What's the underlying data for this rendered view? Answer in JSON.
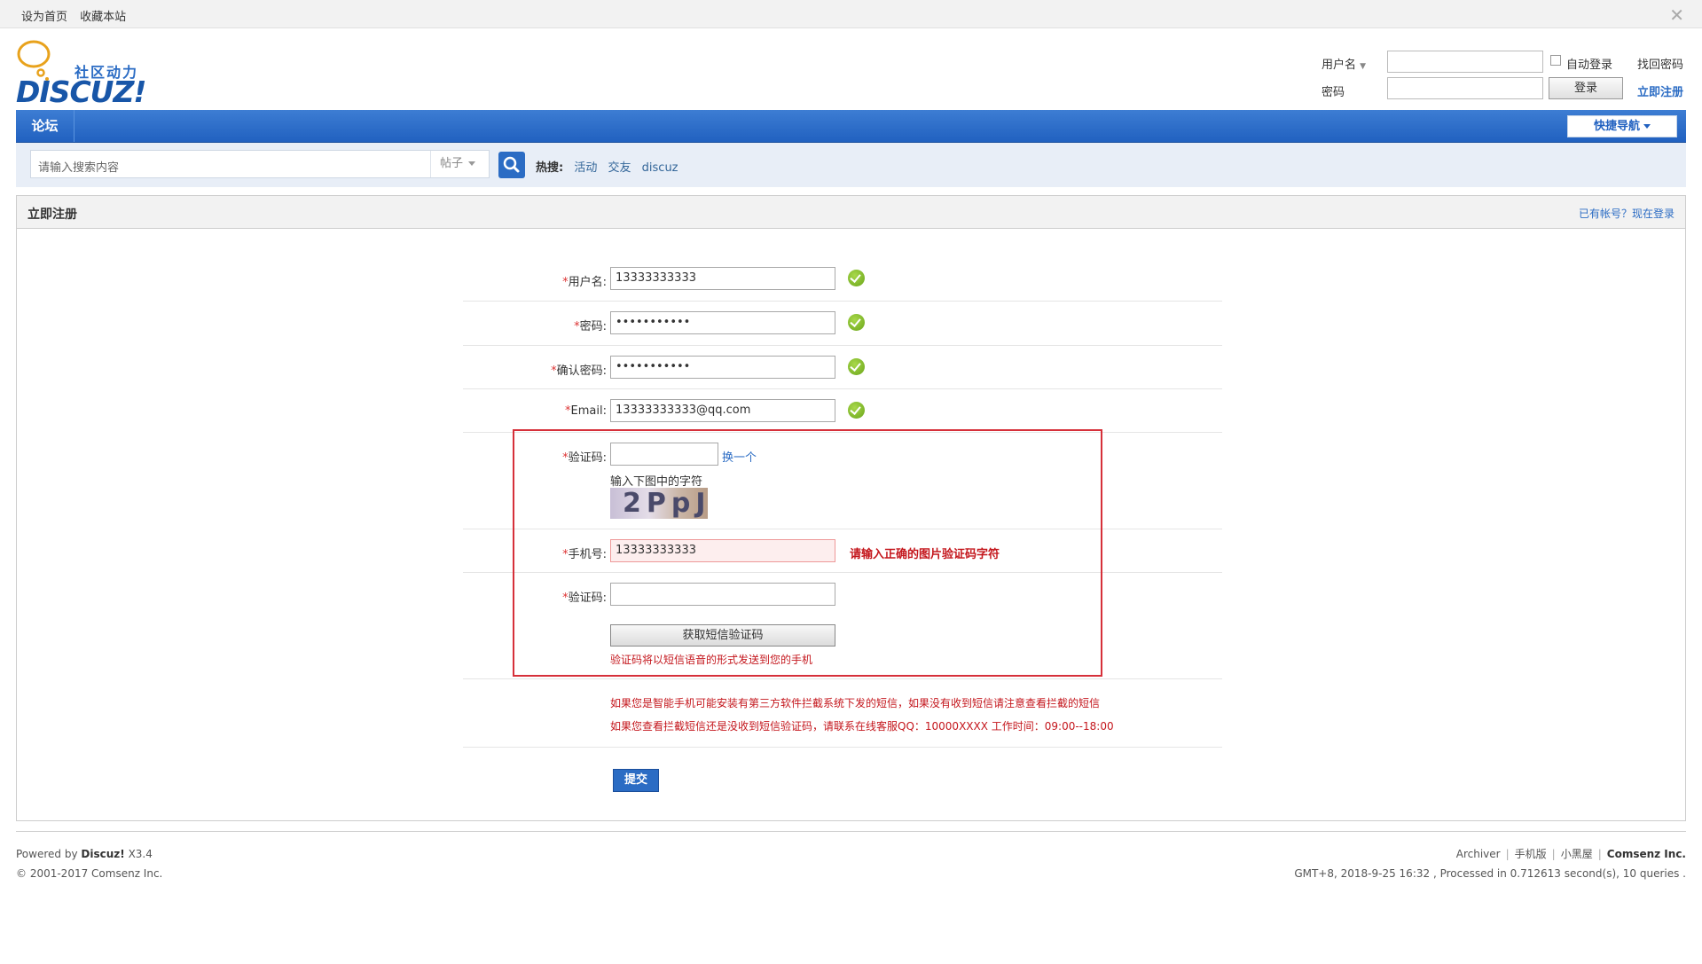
{
  "topbar": {
    "set_home": "设为首页",
    "bookmark": "收藏本站"
  },
  "logo": {
    "tagline": "社区动力",
    "wordmark": "DISCUZ!"
  },
  "login": {
    "username_label": "用户名",
    "password_label": "密码",
    "auto_login": "自动登录",
    "forgot": "找回密码",
    "login_button": "登录",
    "register_link": "立即注册"
  },
  "nav": {
    "forum": "论坛",
    "quick_nav": "快捷导航"
  },
  "search": {
    "placeholder": "请输入搜索内容",
    "type": "帖子",
    "hot_label": "热搜:",
    "hot_tags": [
      "活动",
      "交友",
      "discuz"
    ]
  },
  "panel": {
    "title": "立即注册",
    "already": "已有帐号？现在登录"
  },
  "form": {
    "username": {
      "label": "用户名:",
      "value": "13333333333"
    },
    "password": {
      "label": "密码:",
      "value": "•••••••••••"
    },
    "confirm": {
      "label": "确认密码:",
      "value": "•••••••••••"
    },
    "email": {
      "label": "Email:",
      "value": "13333333333@qq.com"
    },
    "captcha": {
      "label": "验证码:",
      "value": "",
      "refresh": "换一个",
      "hint": "输入下图中的字符",
      "image_text": "2PpJ"
    },
    "phone": {
      "label": "手机号:",
      "value": "13333333333",
      "error": "请输入正确的图片验证码字符"
    },
    "sms_code": {
      "label": "验证码:",
      "value": ""
    },
    "sms_button": "获取短信验证码",
    "sms_note": "验证码将以短信语音的形式发送到您的手机",
    "notice1": "如果您是智能手机可能安装有第三方软件拦截系统下发的短信，如果没有收到短信请注意查看拦截的短信",
    "notice2": "如果您查看拦截短信还是没收到短信验证码，请联系在线客服QQ：10000XXXX 工作时间：09:00--18:00",
    "submit": "提交"
  },
  "footer": {
    "powered_prefix": "Powered by",
    "powered_brand": "Discuz!",
    "powered_version": "X3.4",
    "copyright": "© 2001-2017 Comsenz Inc.",
    "links": [
      "Archiver",
      "手机版",
      "小黑屋"
    ],
    "company": "Comsenz Inc.",
    "stats": "GMT+8, 2018-9-25 16:32 , Processed in 0.712613 second(s), 10 queries ."
  },
  "colors": {
    "accent": "#2b6cc4",
    "error": "#c4161c",
    "highlight_box": "#d6303a",
    "ok": "#6aa51a"
  }
}
